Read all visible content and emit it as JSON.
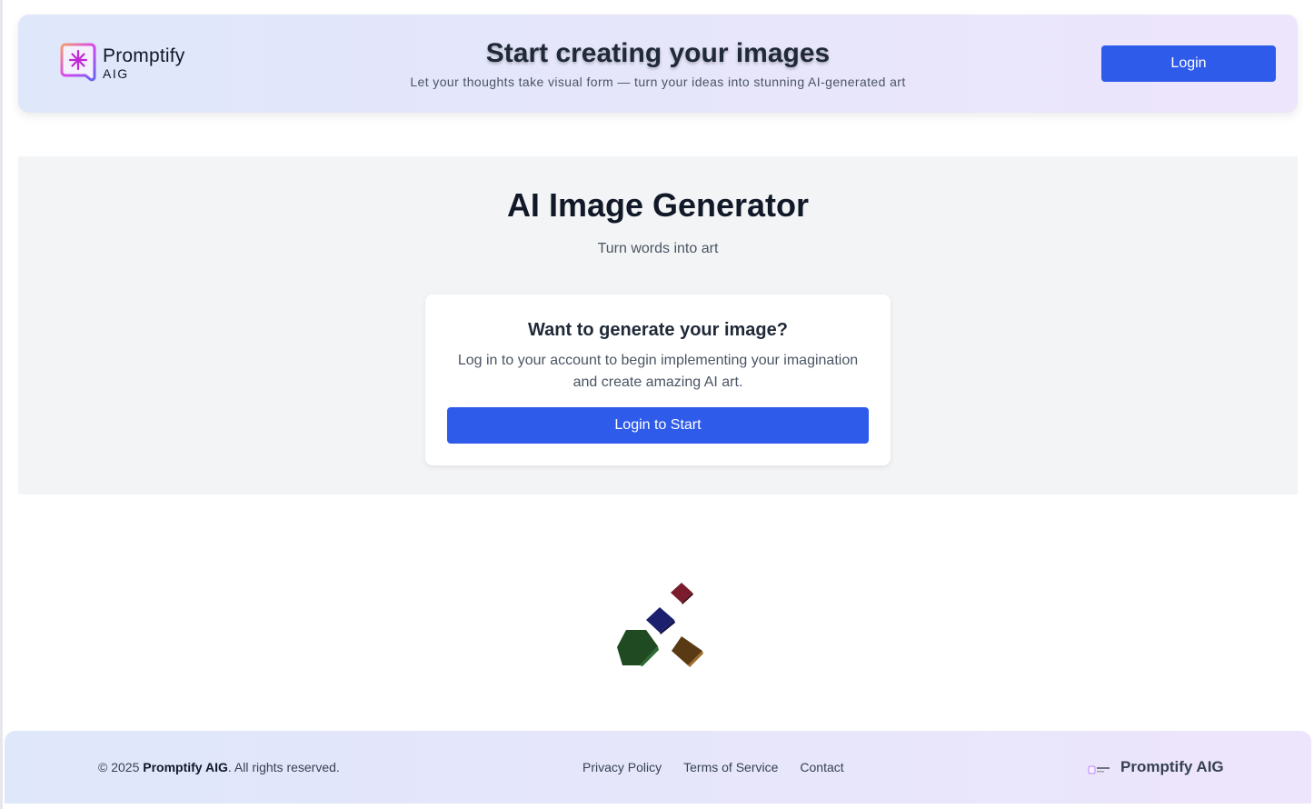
{
  "header": {
    "logo": {
      "name": "Promptify",
      "sub": "AIG",
      "icon": "sparkle-chat-icon"
    },
    "title": "Start creating your images",
    "subtitle": "Let your thoughts take visual form — turn your ideas into stunning AI-generated art",
    "login_label": "Login"
  },
  "hero": {
    "title": "AI Image Generator",
    "subtitle": "Turn words into art",
    "card": {
      "title": "Want to generate your image?",
      "text": "Log in to your account to begin implementing your imagination and create amazing AI art.",
      "button_label": "Login to Start"
    }
  },
  "loader": {
    "icon": "cubes-loading-icon",
    "colors": [
      "#7a1c2c",
      "#1c1f6e",
      "#1f4a22",
      "#5a3a14"
    ]
  },
  "footer": {
    "copyright_prefix": "© 2025 ",
    "copyright_brand": "Promptify AIG",
    "copyright_suffix": ". All rights reserved.",
    "links": [
      {
        "label": "Privacy Policy"
      },
      {
        "label": "Terms of Service"
      },
      {
        "label": "Contact"
      }
    ],
    "brand_name": "Promptify AIG"
  },
  "colors": {
    "accent": "#2f5bea",
    "header_gradient_start": "#dfe7fb",
    "header_gradient_end": "#ede5fb",
    "hero_background": "#f3f4f6"
  }
}
